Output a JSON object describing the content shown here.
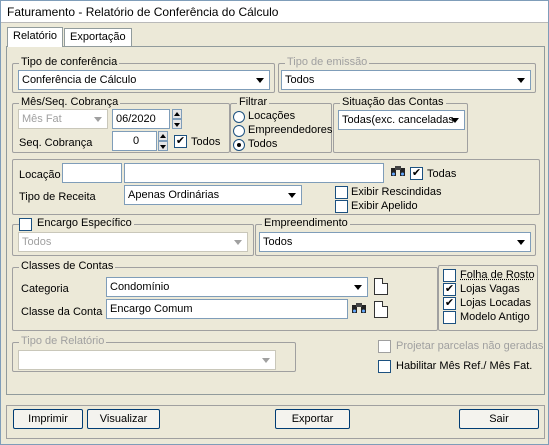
{
  "title": "Faturamento - Relatório de Conferência do Cálculo",
  "tabs": [
    "Relatório",
    "Exportação"
  ],
  "tipo_conferencia": {
    "legend": "Tipo de conferência",
    "value": "Conferência de Cálculo"
  },
  "tipo_emissao": {
    "legend": "Tipo de emissão",
    "value": "Todos"
  },
  "mes_seq": {
    "legend": "Mês/Seq. Cobrança",
    "mes_fat": "Mês Fat",
    "mes_value": "06/2020",
    "seq_label": "Seq. Cobrança",
    "seq_value": "0",
    "todos_label": "Todos"
  },
  "filtrar": {
    "legend": "Filtrar",
    "options": [
      "Locações",
      "Empreendedores",
      "Todos"
    ]
  },
  "situacao": {
    "legend": "Situação das Contas",
    "value": "Todas(exc. canceladas"
  },
  "locacao": {
    "label": "Locação",
    "todas_label": "Todas"
  },
  "tipo_receita": {
    "label": "Tipo de Receita",
    "value": "Apenas Ordinárias"
  },
  "exibir": {
    "rescindidas": "Exibir Rescindidas",
    "apelido": "Exibir Apelido"
  },
  "encargo": {
    "legend": "Encargo Específico",
    "value": "Todos"
  },
  "empreendimento": {
    "legend": "Empreendimento",
    "value": "Todos"
  },
  "classes": {
    "legend": "Classes de Contas",
    "categoria_label": "Categoria",
    "categoria_value": "Condomínio",
    "classe_label": "Classe da Conta",
    "classe_value": "Encargo Comum"
  },
  "options": {
    "folha_rosto": "Folha de Rosto",
    "lojas_vagas": "Lojas Vagas",
    "lojas_locadas": "Lojas Locadas",
    "modelo_antigo": "Modelo Antigo"
  },
  "tipo_relatorio": {
    "legend": "Tipo de Relatório"
  },
  "projetar": "Projetar parcelas não geradas",
  "habilitar": "Habilitar Mês Ref./ Mês Fat.",
  "buttons": {
    "imprimir": "Imprimir",
    "visualizar": "Visualizar",
    "exportar": "Exportar",
    "sair": "Sair"
  }
}
